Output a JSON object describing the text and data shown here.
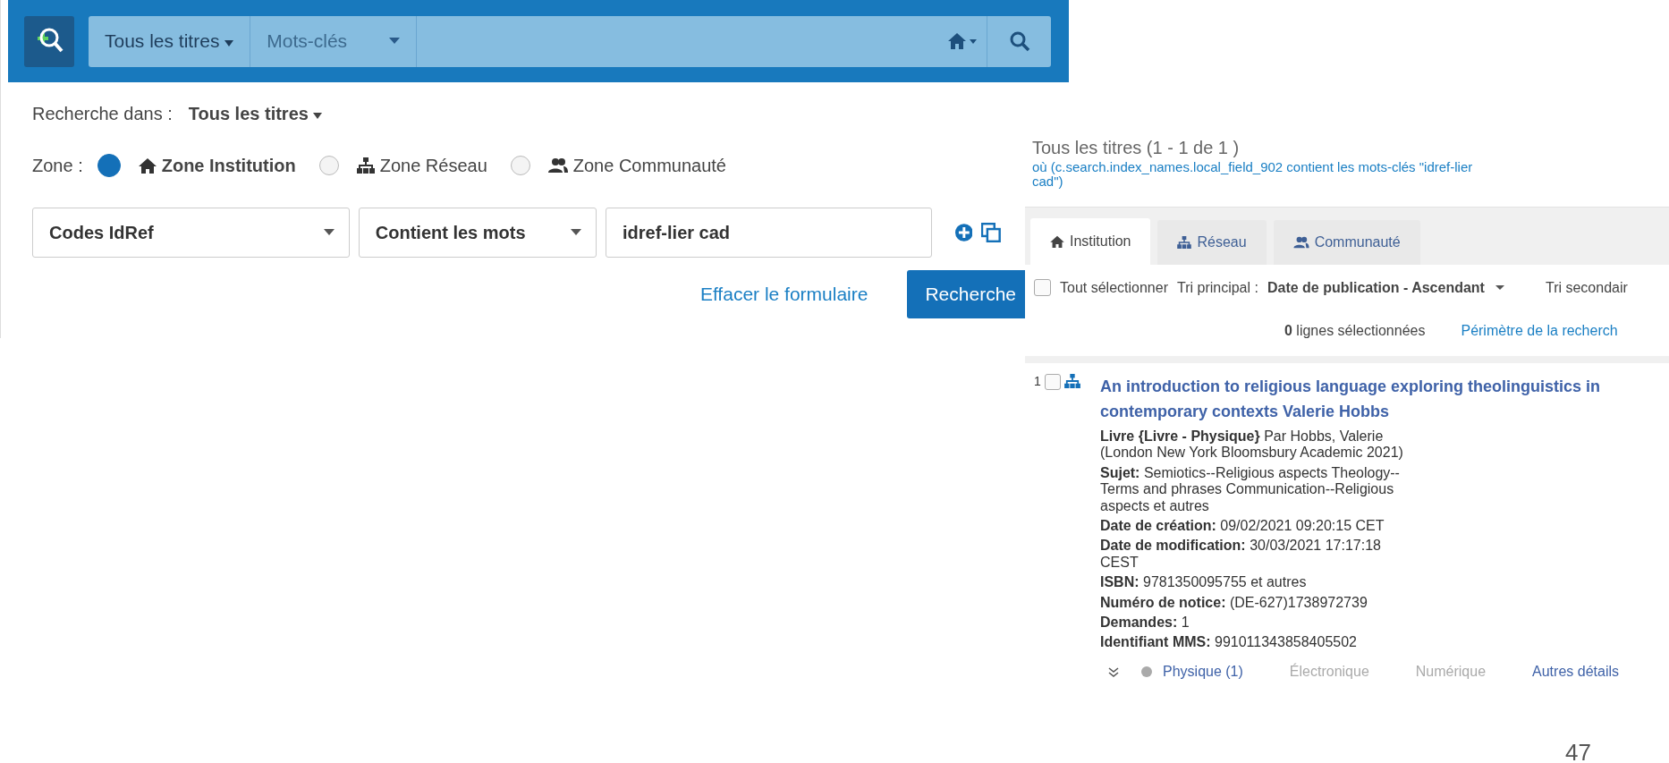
{
  "search_bar": {
    "scope": "Tous les titres",
    "index": "Mots-clés"
  },
  "search_form": {
    "scope_label": "Recherche dans :",
    "scope_value": "Tous les titres",
    "zone_label": "Zone :",
    "zones": [
      {
        "label": "Zone Institution",
        "selected": true
      },
      {
        "label": "Zone Réseau",
        "selected": false
      },
      {
        "label": "Zone Communauté",
        "selected": false
      }
    ],
    "field": "Codes IdRef",
    "operator": "Contient les mots",
    "value": "idref-lier cad",
    "clear_link": "Effacer le formulaire",
    "search_button": "Recherche"
  },
  "results": {
    "title": "Tous les titres (1 - 1 de 1 )",
    "query": "où (c.search.index_names.local_field_902 contient les mots-clés \"idref-lier cad\")",
    "tabs": [
      {
        "label": "Institution",
        "selected": true
      },
      {
        "label": "Réseau",
        "selected": false
      },
      {
        "label": "Communauté",
        "selected": false
      }
    ],
    "select_all": {
      "label": "Tout sélectionner",
      "checked": false
    },
    "sort_label": "Tri principal :",
    "sort_value": "Date de publication - Ascendant",
    "secondary_sort": "Tri secondair",
    "selected_text": "**0** lignes sélectionnées",
    "scope_link": "Périmètre de la recherch",
    "items": [
      {
        "number": "1",
        "checked": false,
        "title": "An introduction to religious language exploring theolinguistics in contemporary contexts Valerie Hobbs",
        "details": [
          "**Livre {Livre - Physique}** Par Hobbs, Valerie (London New York Bloomsbury Academic 2021)",
          "**Sujet:** Semiotics--Religious aspects Theology--Terms and phrases Communication--Religious aspects et autres",
          "**Date de création:** 09/02/2021 09:20:15 CET",
          "**Date de modification:** 30/03/2021 17:17:18 CEST",
          "**ISBN:** 9781350095755 et autres",
          "**Numéro de notice:** (DE-627)1738972739",
          "**Demandes:** 1",
          "**Identifiant MMS:** 991011343858405502"
        ],
        "availability": [
          {
            "label": "Physique (1)",
            "available": true
          },
          {
            "label": "Électronique",
            "available": false
          },
          {
            "label": "Numérique",
            "available": false
          },
          {
            "label": "Autres détails",
            "available": true
          }
        ]
      }
    ]
  },
  "page_number": "47"
}
